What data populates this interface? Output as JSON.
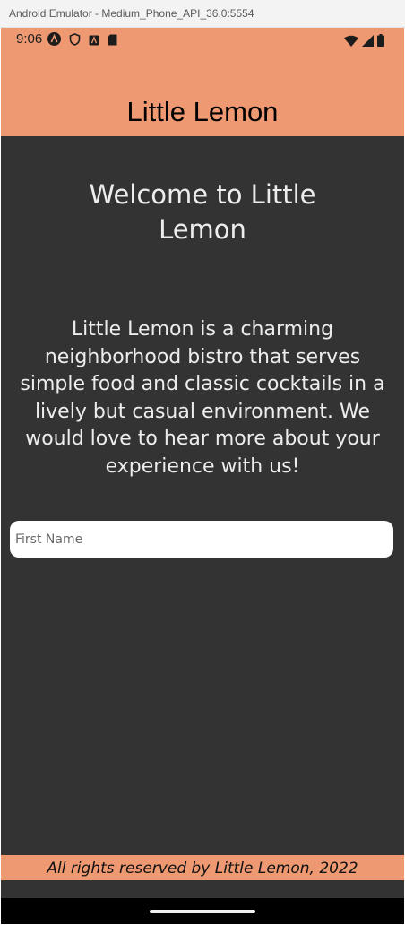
{
  "window": {
    "title": "Android Emulator - Medium_Phone_API_36.0:5554"
  },
  "status_bar": {
    "time": "9:06",
    "left_icons": [
      "app-a-icon",
      "shield-icon",
      "app-badge-icon",
      "sd-card-icon"
    ],
    "right_icons": [
      "wifi-icon",
      "cellular-signal-icon",
      "battery-icon"
    ]
  },
  "header": {
    "title": "Little Lemon"
  },
  "main": {
    "welcome_title": "Welcome to Little Lemon",
    "about_text": "Little Lemon is a charming neighborhood bistro that serves simple food and classic cocktails in a lively but casual environment. We would love to hear more about your experience with us!",
    "first_name": {
      "value": "",
      "placeholder": "First Name"
    }
  },
  "footer": {
    "text": "All rights reserved by Little Lemon, 2022"
  },
  "colors": {
    "brand_header": "#ee9972",
    "background": "#333333",
    "text_light": "#ededed"
  }
}
